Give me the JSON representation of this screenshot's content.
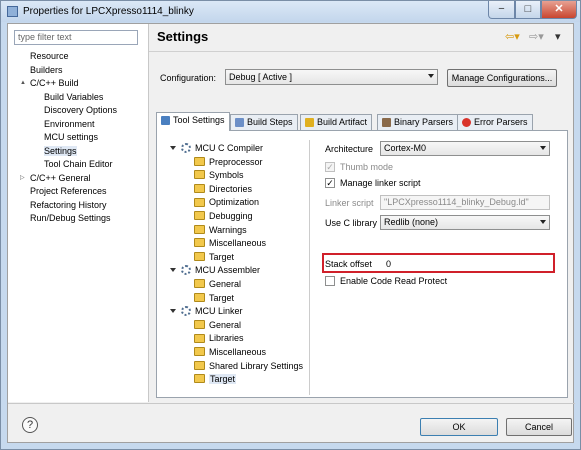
{
  "window": {
    "title": "Properties for LPCXpresso1114_blinky",
    "controls": {
      "minimize": "−",
      "maximize": "□",
      "close": "✕"
    }
  },
  "sidebar": {
    "filter_placeholder": "type filter text",
    "items": [
      {
        "label": "Resource",
        "level": 0,
        "expander": ""
      },
      {
        "label": "Builders",
        "level": 0,
        "expander": ""
      },
      {
        "label": "C/C++ Build",
        "level": 0,
        "expander": "▲"
      },
      {
        "label": "Build Variables",
        "level": 1,
        "expander": ""
      },
      {
        "label": "Discovery Options",
        "level": 1,
        "expander": ""
      },
      {
        "label": "Environment",
        "level": 1,
        "expander": ""
      },
      {
        "label": "MCU settings",
        "level": 1,
        "expander": ""
      },
      {
        "label": "Settings",
        "level": 1,
        "expander": "",
        "selected": true
      },
      {
        "label": "Tool Chain Editor",
        "level": 1,
        "expander": ""
      },
      {
        "label": "C/C++ General",
        "level": 0,
        "expander": "▷"
      },
      {
        "label": "Project References",
        "level": 0,
        "expander": ""
      },
      {
        "label": "Refactoring History",
        "level": 0,
        "expander": ""
      },
      {
        "label": "Run/Debug Settings",
        "level": 0,
        "expander": ""
      }
    ]
  },
  "header": {
    "title": "Settings",
    "back_icon": "back-arrow-icon",
    "forward_icon": "forward-arrow-icon"
  },
  "configuration": {
    "label": "Configuration:",
    "value": "Debug  [ Active ]",
    "manage_label": "Manage Configurations..."
  },
  "tabs": [
    {
      "label": "Tool Settings",
      "active": true,
      "icon_color": "#4a7fc0"
    },
    {
      "label": "Build Steps",
      "active": false,
      "icon_color": "#6c8fc7"
    },
    {
      "label": "Build Artifact",
      "active": false,
      "icon_color": "#e0b020"
    },
    {
      "label": "Binary Parsers",
      "active": false,
      "icon_color": "#8a6a4a"
    },
    {
      "label": "Error Parsers",
      "active": false,
      "icon_color": "#d9342b"
    }
  ],
  "tool_tree": [
    {
      "label": "MCU C Compiler",
      "type": "tool",
      "level": 0
    },
    {
      "label": "Preprocessor",
      "type": "folder",
      "level": 1
    },
    {
      "label": "Symbols",
      "type": "folder",
      "level": 1
    },
    {
      "label": "Directories",
      "type": "folder",
      "level": 1
    },
    {
      "label": "Optimization",
      "type": "folder",
      "level": 1
    },
    {
      "label": "Debugging",
      "type": "folder",
      "level": 1
    },
    {
      "label": "Warnings",
      "type": "folder",
      "level": 1
    },
    {
      "label": "Miscellaneous",
      "type": "folder",
      "level": 1
    },
    {
      "label": "Target",
      "type": "folder",
      "level": 1
    },
    {
      "label": "MCU Assembler",
      "type": "tool",
      "level": 0
    },
    {
      "label": "General",
      "type": "folder",
      "level": 1
    },
    {
      "label": "Target",
      "type": "folder",
      "level": 1
    },
    {
      "label": "MCU Linker",
      "type": "tool",
      "level": 0
    },
    {
      "label": "General",
      "type": "folder",
      "level": 1
    },
    {
      "label": "Libraries",
      "type": "folder",
      "level": 1
    },
    {
      "label": "Miscellaneous",
      "type": "folder",
      "level": 1
    },
    {
      "label": "Shared Library Settings",
      "type": "folder",
      "level": 1
    },
    {
      "label": "Target",
      "type": "folder",
      "level": 1,
      "selected": true
    }
  ],
  "form": {
    "architecture_label": "Architecture",
    "architecture_value": "Cortex-M0",
    "thumb_mode_label": "Thumb mode",
    "thumb_mode_checked": true,
    "manage_linker_label": "Manage linker script",
    "manage_linker_checked": true,
    "linker_script_label": "Linker script",
    "linker_script_value": "\"LPCXpresso1114_blinky_Debug.ld\"",
    "use_c_library_label": "Use C library",
    "use_c_library_value": "Redlib (none)",
    "stack_offset_label": "Stack offset",
    "stack_offset_value": "0",
    "code_read_protect_label": "Enable Code Read Protect",
    "code_read_protect_checked": false
  },
  "footer": {
    "help_label": "?",
    "ok_label": "OK",
    "cancel_label": "Cancel"
  },
  "colors": {
    "highlight": "#d0202a",
    "selection": "#dfe8f4"
  }
}
